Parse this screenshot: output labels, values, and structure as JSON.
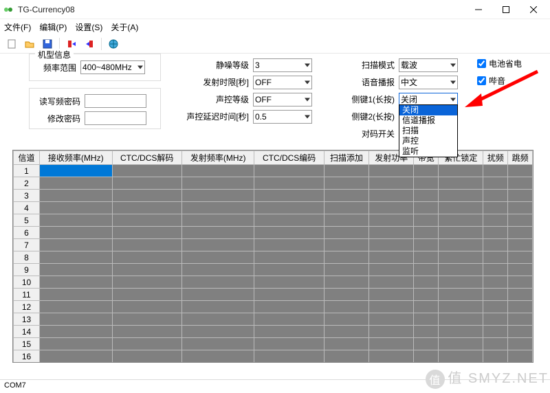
{
  "window": {
    "title": "TG-Currency08"
  },
  "menu": {
    "file": "文件(F)",
    "edit": "编辑(P)",
    "settings": "设置(S)",
    "about": "关于(A)"
  },
  "group": {
    "model": {
      "label": "机型信息",
      "freqLabel": "频率范围",
      "freqValue": "400~480MHz"
    },
    "pwd": {
      "readLabel": "读写频密码",
      "modifyLabel": "修改密码"
    }
  },
  "opts": {
    "sql": {
      "label": "静噪等级",
      "value": "3"
    },
    "txlimit": {
      "label": "发射时限[秒]",
      "value": "OFF"
    },
    "vox": {
      "label": "声控等级",
      "value": "OFF"
    },
    "voxdelay": {
      "label": "声控延迟时间[秒]",
      "value": "0.5"
    },
    "scanmode": {
      "label": "扫描模式",
      "value": "载波"
    },
    "voiceprompt": {
      "label": "语音播报",
      "value": "中文"
    },
    "side1": {
      "label": "侧键1(长按)",
      "value": "关闭"
    },
    "side2": {
      "label": "侧键2(长按)",
      "value": ""
    },
    "match": {
      "label": "对码开关",
      "value": ""
    },
    "batt": {
      "label": "电池省电"
    },
    "beep": {
      "label": "哔音"
    }
  },
  "dropdown": {
    "items": [
      "关闭",
      "信道播报",
      "扫描",
      "声控",
      "监听"
    ]
  },
  "table": {
    "headers": [
      "信道",
      "接收频率(MHz)",
      "CTC/DCS解码",
      "发射频率(MHz)",
      "CTC/DCS编码",
      "扫描添加",
      "发射功率",
      "带宽",
      "繁忙锁定",
      "扰频",
      "跳频"
    ],
    "rows": [
      "1",
      "2",
      "3",
      "4",
      "5",
      "6",
      "7",
      "8",
      "9",
      "10",
      "11",
      "12",
      "13",
      "14",
      "15",
      "16"
    ]
  },
  "status": {
    "com": "COM7"
  },
  "watermark": "值 SMYZ.NET"
}
